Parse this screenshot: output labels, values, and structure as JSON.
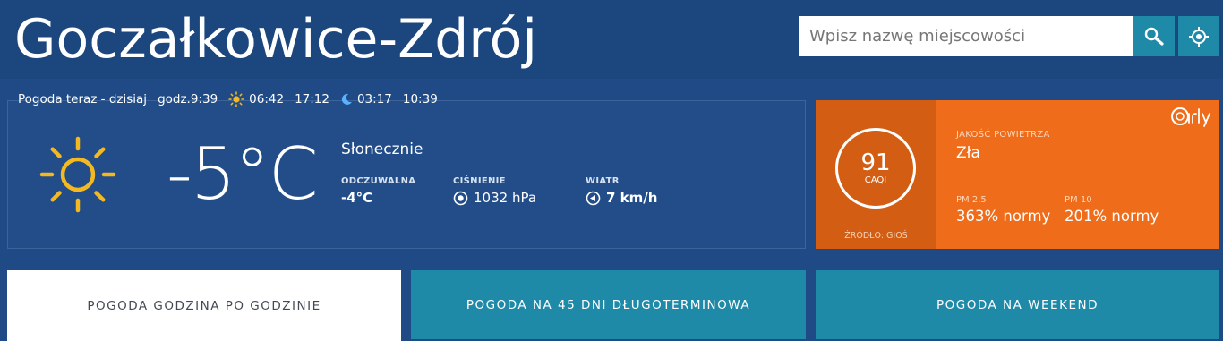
{
  "header": {
    "city": "Goczałkowice-Zdrój",
    "search_placeholder": "Wpisz nazwę miejscowości",
    "search_icon": "search-icon",
    "locate_icon": "locate-icon"
  },
  "now": {
    "label": "Pogoda teraz - dzisiaj",
    "time": "godz.9:39",
    "sunrise": "06:42",
    "sunset": "17:12",
    "moonrise": "03:17",
    "moonset": "10:39"
  },
  "weather": {
    "temperature": "-5°C",
    "condition": "Słonecznie",
    "feels_label": "ODCZUWALNA",
    "feels_value": "-4°C",
    "pressure_label": "CIŚNIENIE",
    "pressure_value": "1032 hPa",
    "wind_label": "WIATR",
    "wind_value": "7 km/h",
    "icon": "sun-icon"
  },
  "air_quality": {
    "index": "91",
    "unit": "CAQI",
    "source": "ŹRÓDŁO: GIOŚ",
    "title": "JAKOŚĆ POWIETRZA",
    "level": "Zła",
    "pm25_label": "PM 2.5",
    "pm25_value": "363% normy",
    "pm10_label": "PM 10",
    "pm10_value": "201% normy",
    "logo": "airly-logo"
  },
  "tabs": [
    {
      "label": "POGODA GODZINA PO GODZINIE"
    },
    {
      "label": "POGODA NA 45 DNI DŁUGOTERMINOWA"
    },
    {
      "label": "POGODA NA WEEKEND"
    }
  ],
  "colors": {
    "background": "#1c467e",
    "card": "#224d89",
    "teal": "#1f8aa8",
    "aq_dark": "#d25d13",
    "aq_orange": "#ee6c1a",
    "sun": "#f4b920"
  }
}
